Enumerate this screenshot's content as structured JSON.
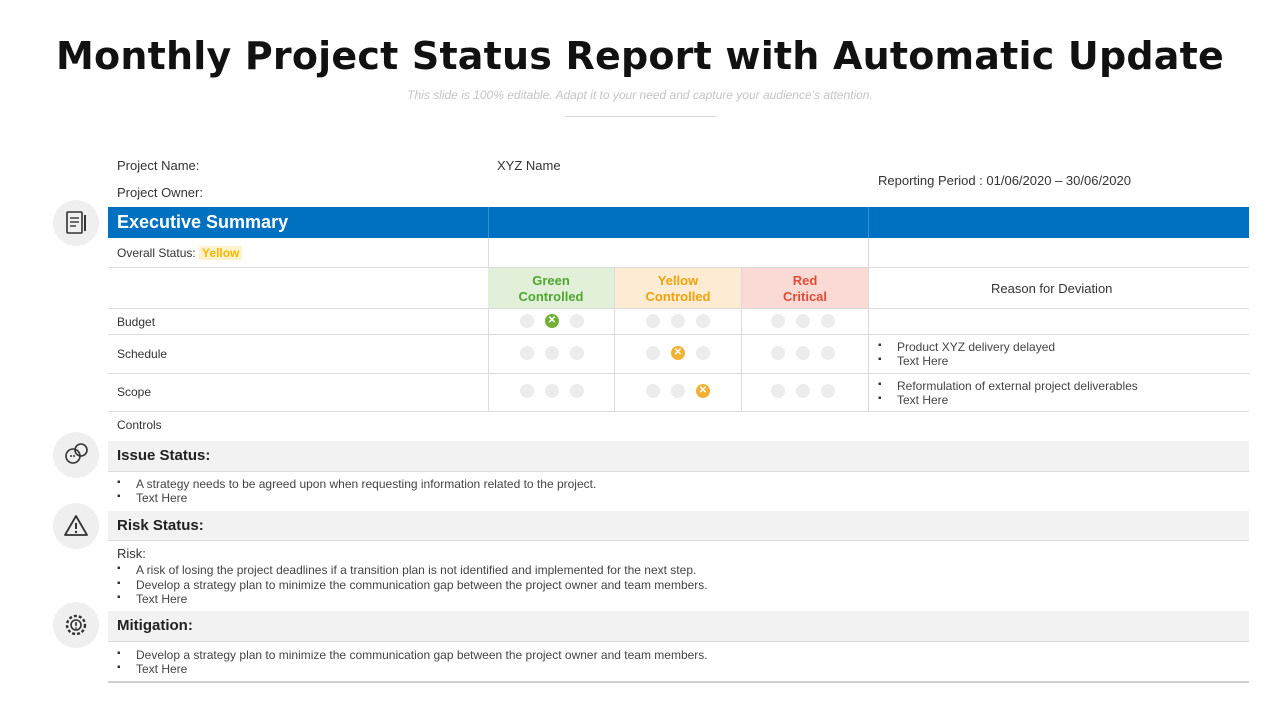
{
  "title": "Monthly Project Status Report with Automatic Update",
  "subtitle": "This slide is 100% editable. Adapt it to your need and capture your audience’s attention.",
  "header": {
    "project_name_label": "Project Name:",
    "project_name_value": "XYZ Name",
    "project_owner_label": "Project Owner:",
    "reporting_period": "Reporting Period : 01/06/2020 – 30/06/2020"
  },
  "executive_summary": {
    "heading": "Executive Summary",
    "overall_status_label": "Overall Status:",
    "overall_status_value": "Yellow"
  },
  "columns": {
    "green": [
      "Green",
      "Controlled"
    ],
    "yellow": [
      "Yellow",
      "Controlled"
    ],
    "red": [
      "Red",
      "Critical"
    ],
    "reason": "Reason for Deviation"
  },
  "rows": [
    {
      "label": "Budget",
      "status": "green",
      "active_index": 1,
      "reasons": []
    },
    {
      "label": "Schedule",
      "status": "yellow",
      "active_index": 1,
      "reasons": [
        "Product XYZ delivery delayed",
        "Text Here"
      ]
    },
    {
      "label": "Scope",
      "status": "yellow",
      "active_index": 2,
      "reasons": [
        "Reformulation of external project deliverables",
        "Text Here"
      ]
    }
  ],
  "controls_label": "Controls",
  "issue_status": {
    "heading": "Issue Status:",
    "items": [
      "A strategy needs to be agreed upon when requesting information related to the project.",
      "Text Here"
    ]
  },
  "risk_status": {
    "heading": "Risk Status:",
    "sub_label": "Risk:",
    "items": [
      "A risk of losing the project deadlines if a transition plan is not identified and implemented for the next step.",
      "Develop a strategy plan to minimize the communication gap between the project owner and team members.",
      "Text Here"
    ]
  },
  "mitigation": {
    "heading": "Mitigation:",
    "items": [
      "Develop a strategy plan to minimize the communication gap between the project owner and team members.",
      "Text Here"
    ]
  },
  "icons": [
    "report-icon",
    "discussion-icon",
    "warning-icon",
    "gear-icon"
  ],
  "colors": {
    "accent": "#0070c0",
    "green": "#72b136",
    "yellow": "#f2b134",
    "red": "#e04b35"
  }
}
